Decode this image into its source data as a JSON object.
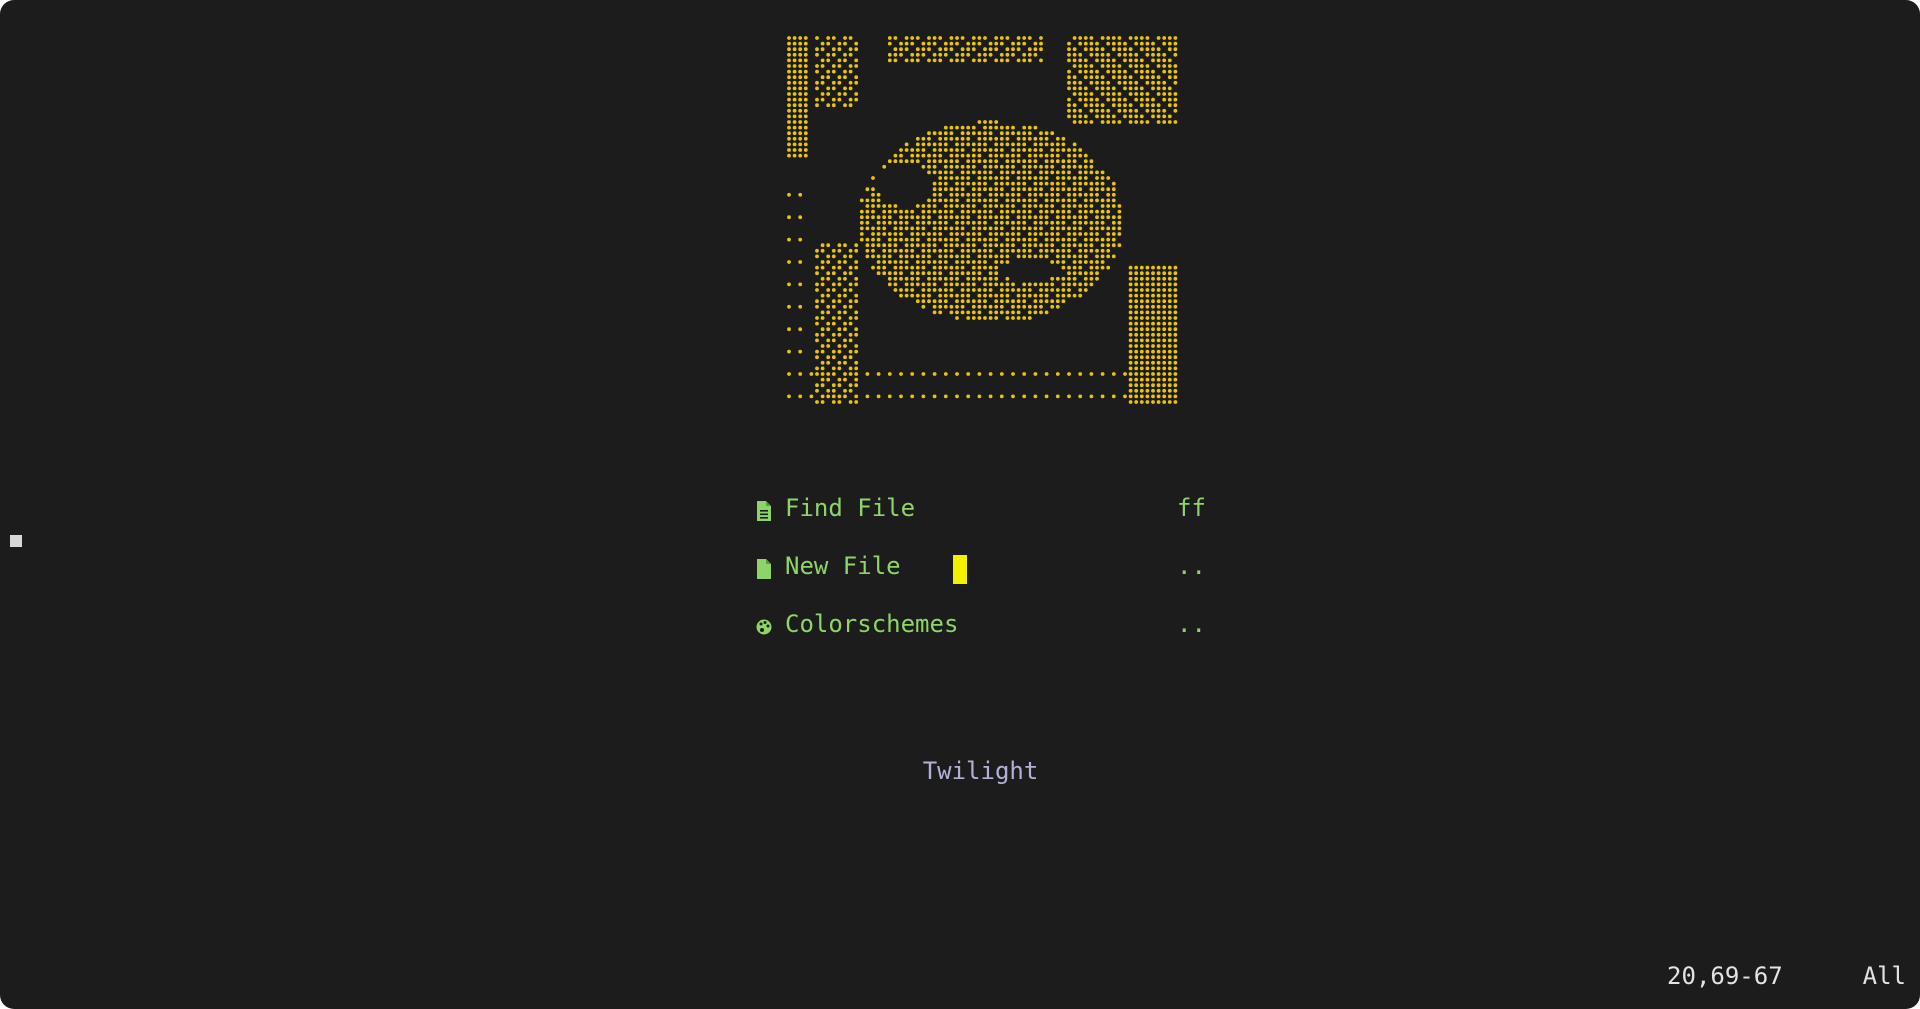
{
  "dashboard": {
    "menu": [
      {
        "icon": "file-text-icon",
        "label": "Find File",
        "shortcut": "ff"
      },
      {
        "icon": "file-icon",
        "label": "New File",
        "shortcut": ".."
      },
      {
        "icon": "palette-icon",
        "label": "Colorschemes",
        "shortcut": ".."
      }
    ],
    "footer": "Twilight"
  },
  "statusline": {
    "position": "20,69-67",
    "scroll": "All"
  },
  "colors": {
    "background": "#1c1c1c",
    "banner": "#e8c20c",
    "menu_text": "#8fd468",
    "footer_text": "#b2b0d9",
    "cursor": "#f2f200"
  },
  "banner": {
    "icon": "braille-art-image"
  }
}
